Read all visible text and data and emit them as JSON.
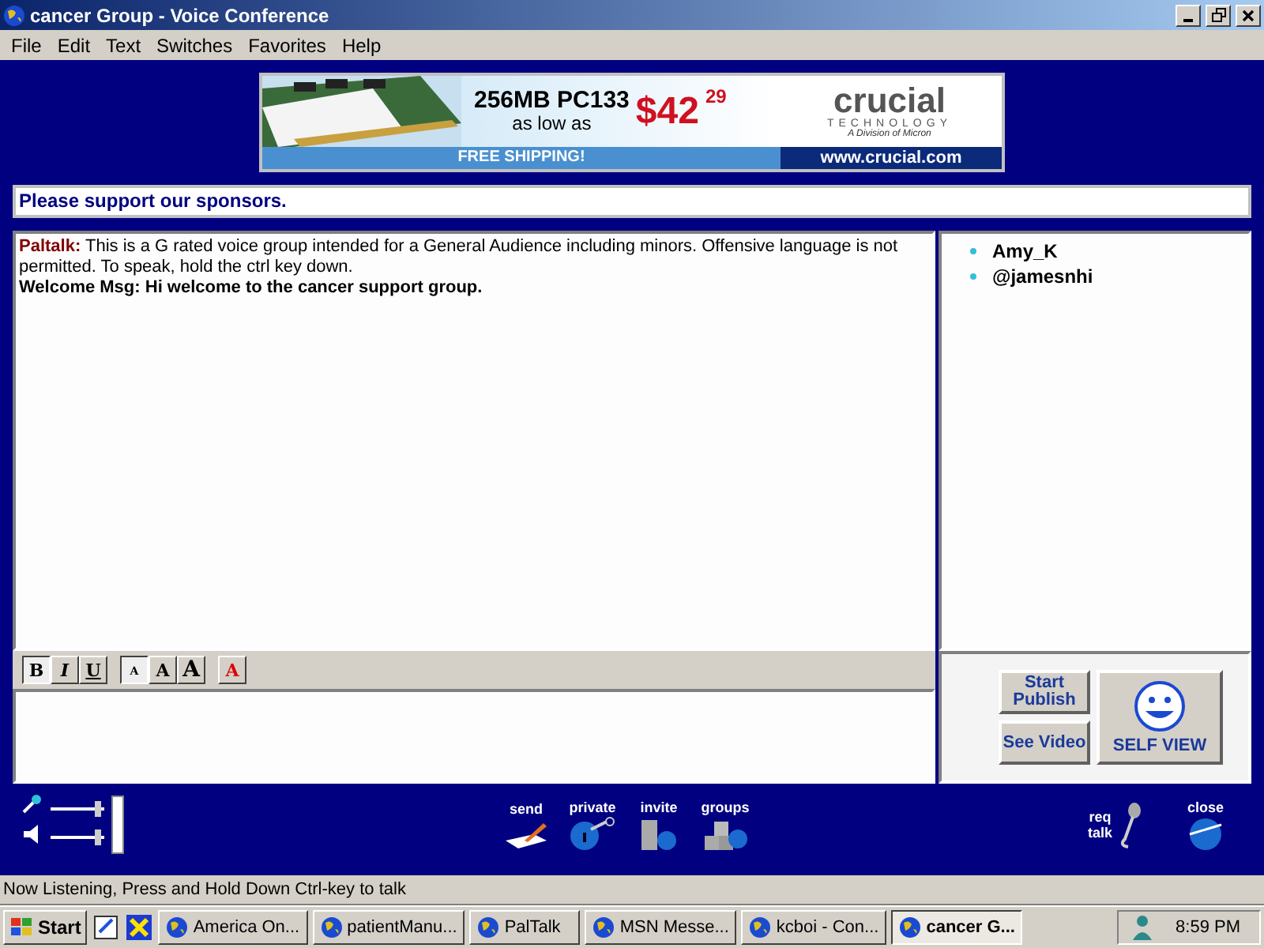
{
  "window": {
    "title": "cancer Group - Voice Conference"
  },
  "menu": [
    "File",
    "Edit",
    "Text",
    "Switches",
    "Favorites",
    "Help"
  ],
  "banner": {
    "headline": "256MB PC133",
    "subline": "as low as",
    "price": "$42",
    "cents": "29",
    "brand": "crucial",
    "brand_sub": "TECHNOLOGY",
    "division": "A Division of Micron",
    "shipping": "FREE SHIPPING!",
    "url": "www.crucial.com"
  },
  "sponsor_bar": "Please support our sponsors.",
  "chat": [
    {
      "speaker": "Paltalk:",
      "text": "This is a G rated voice group intended for a General Audience including minors.  Offensive language is not permitted.  To speak, hold the ctrl key down.",
      "kind": "system"
    },
    {
      "speaker": "Welcome Msg:",
      "text": "Hi welcome to the cancer support group.",
      "kind": "welcome"
    }
  ],
  "users": [
    "Amy_K",
    "@jamesnhi"
  ],
  "format_buttons": [
    {
      "label": "B",
      "kind": "bold",
      "selected": true
    },
    {
      "label": "I",
      "kind": "italic",
      "selected": false
    },
    {
      "label": "U",
      "kind": "underline",
      "selected": false
    },
    {
      "label": "A",
      "kind": "small",
      "selected": true
    },
    {
      "label": "A",
      "kind": "medium",
      "selected": false
    },
    {
      "label": "A",
      "kind": "large",
      "selected": false
    },
    {
      "label": "A",
      "kind": "color",
      "selected": false
    }
  ],
  "video_buttons": [
    "Start Publish",
    "See Video"
  ],
  "self_view": "SELF VIEW",
  "actions": [
    {
      "label": "send",
      "kind": "send"
    },
    {
      "label": "private",
      "kind": "private"
    },
    {
      "label": "invite",
      "kind": "invite"
    },
    {
      "label": "groups",
      "kind": "groups"
    }
  ],
  "req_talk": [
    "req",
    "talk"
  ],
  "close": "close",
  "status": "Now Listening, Press and Hold Down Ctrl-key to talk",
  "taskbar": {
    "start": "Start",
    "tasks": [
      {
        "label": "America  On...",
        "selected": false
      },
      {
        "label": "patientManu...",
        "selected": false
      },
      {
        "label": "PalTalk",
        "selected": false
      },
      {
        "label": "MSN Messe...",
        "selected": false
      },
      {
        "label": "kcboi - Con...",
        "selected": false
      },
      {
        "label": "cancer G...",
        "selected": true
      }
    ],
    "clock": "8:59 PM"
  }
}
